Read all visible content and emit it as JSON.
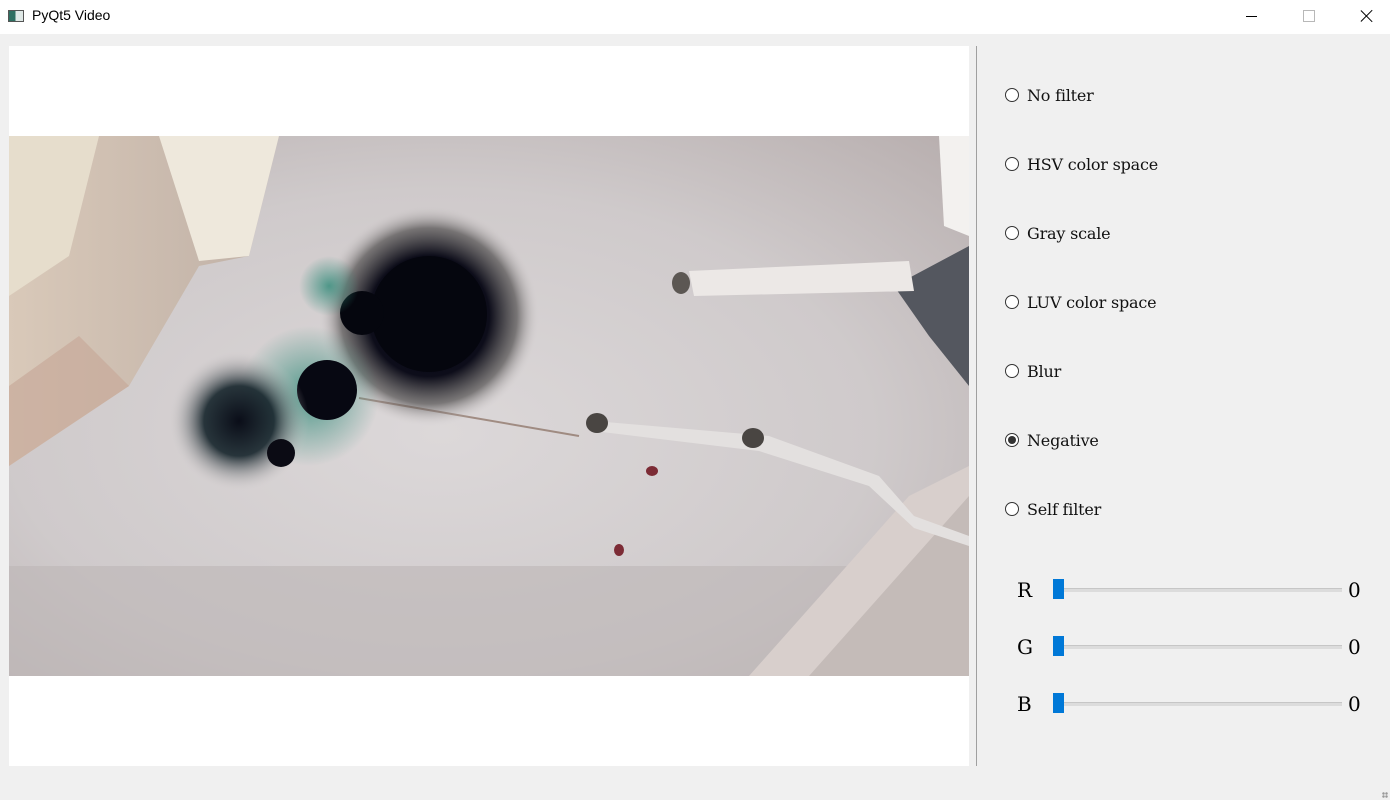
{
  "window": {
    "title": "PyQt5 Video",
    "icon": "app-window-icon",
    "controls": [
      "minimize-icon",
      "maximize-icon",
      "close-icon"
    ]
  },
  "video": {
    "filter_applied": "Negative"
  },
  "filters": [
    {
      "label": "No filter",
      "checked": false
    },
    {
      "label": "HSV color space",
      "checked": false
    },
    {
      "label": "Gray scale",
      "checked": false
    },
    {
      "label": "LUV color space",
      "checked": false
    },
    {
      "label": "Blur",
      "checked": false
    },
    {
      "label": "Negative",
      "checked": true
    },
    {
      "label": "Self filter",
      "checked": false
    }
  ],
  "sliders": [
    {
      "label": "R",
      "value": "0",
      "level": 0
    },
    {
      "label": "G",
      "value": "0",
      "level": 0
    },
    {
      "label": "B",
      "value": "0",
      "level": 0
    }
  ],
  "colors": {
    "accent": "#0078d7",
    "background": "#f0f0f0"
  }
}
